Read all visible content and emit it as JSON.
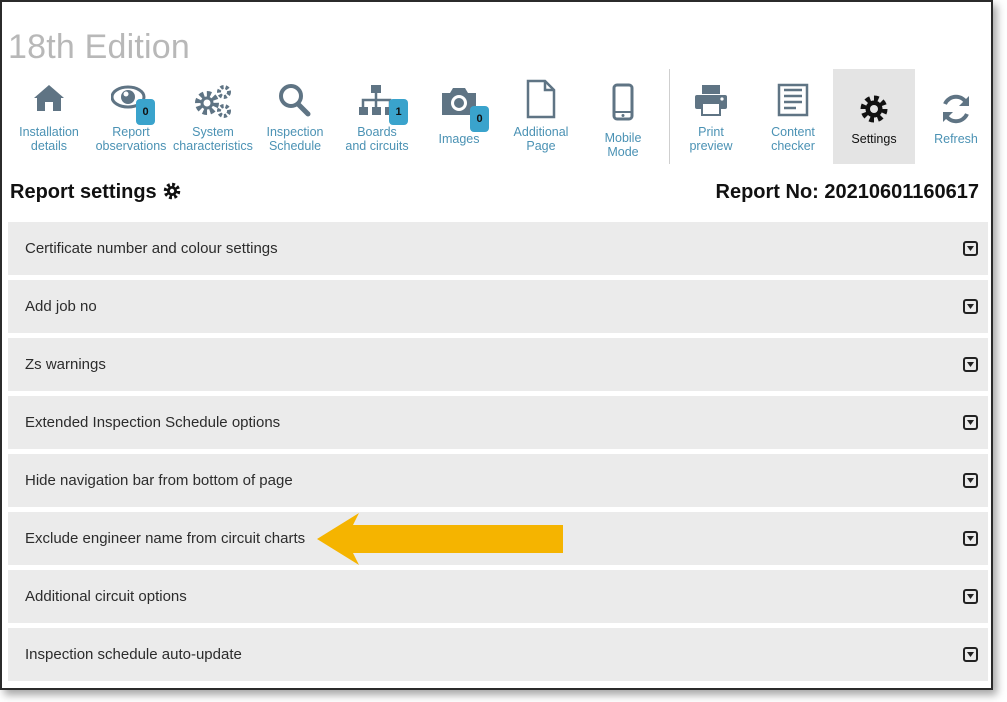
{
  "app": {
    "edition": "18th Edition"
  },
  "toolbar": [
    {
      "label": "Installation\ndetails",
      "icon": "home-icon"
    },
    {
      "label": "Report\nobservations",
      "icon": "eye-icon",
      "badge": "0"
    },
    {
      "label": "System\ncharacteristics",
      "icon": "gears-icon"
    },
    {
      "label": "Inspection\nSchedule",
      "icon": "search-icon"
    },
    {
      "label": "Boards\nand circuits",
      "icon": "sitemap-icon",
      "badge": "1"
    },
    {
      "label": "Images",
      "icon": "camera-icon",
      "badge": "0"
    },
    {
      "label": "Additional\nPage",
      "icon": "file-icon"
    },
    {
      "label": "Mobile\nMode",
      "icon": "mobile-icon"
    },
    {
      "label": "Print\npreview",
      "icon": "print-icon"
    },
    {
      "label": "Content\nchecker",
      "icon": "checklist-icon"
    },
    {
      "label": "Settings",
      "icon": "settings-gear-icon"
    },
    {
      "label": "Refresh",
      "icon": "refresh-icon"
    }
  ],
  "header": {
    "title": "Report settings",
    "report_no": "Report No: 20210601160617"
  },
  "settings": [
    "Certificate number and colour settings",
    "Add job no",
    "Zs warnings",
    "Extended Inspection Schedule options",
    "Hide navigation bar from bottom of page",
    "Exclude engineer name from circuit charts",
    "Additional circuit options",
    "Inspection schedule auto-update"
  ],
  "colors": {
    "accent": "#4b92b4",
    "badge": "#3aa3cc",
    "row_bg": "#ebebeb",
    "arrow": "#f5b400"
  }
}
